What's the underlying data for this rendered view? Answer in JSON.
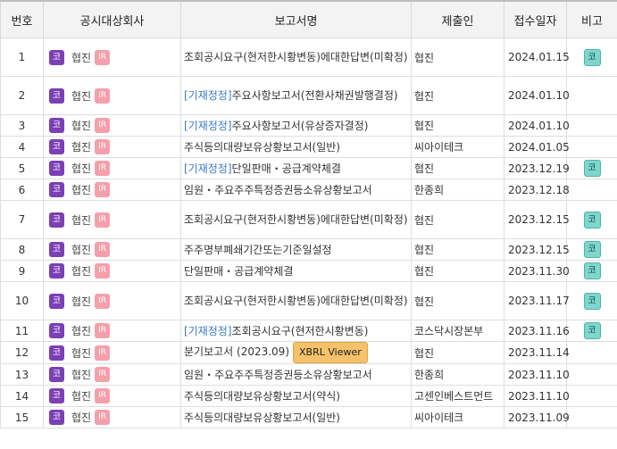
{
  "headers": [
    "번호",
    "공시대상회사",
    "보고서명",
    "제출인",
    "접수일자",
    "비고"
  ],
  "badges": {
    "market": "코",
    "ir": "IR",
    "xbrl": "XBRL Viewer",
    "note": "코"
  },
  "rows": [
    {
      "no": "1",
      "company": "협진",
      "prefix": "",
      "title": "조회공시요구(현저한시황변동)에대한답변(미확정)",
      "submitter": "협진",
      "date": "2024.01.15",
      "note": "코"
    },
    {
      "no": "2",
      "company": "협진",
      "prefix": "[기재정정]",
      "title": "주요사항보고서(전환사채권발행결정)",
      "submitter": "협진",
      "date": "2024.01.10",
      "note": ""
    },
    {
      "no": "3",
      "company": "협진",
      "prefix": "[기재정정]",
      "title": "주요사항보고서(유상증자결정)",
      "submitter": "협진",
      "date": "2024.01.10",
      "note": ""
    },
    {
      "no": "4",
      "company": "협진",
      "prefix": "",
      "title": "주식등의대량보유상황보고서(일반)",
      "submitter": "씨아이테크",
      "date": "2024.01.05",
      "note": ""
    },
    {
      "no": "5",
      "company": "협진",
      "prefix": "[기재정정]",
      "title": "단일판매・공급계약체결",
      "submitter": "협진",
      "date": "2023.12.19",
      "note": "코"
    },
    {
      "no": "6",
      "company": "협진",
      "prefix": "",
      "title": "임원・주요주주특정증권등소유상황보고서",
      "submitter": "한종희",
      "date": "2023.12.18",
      "note": ""
    },
    {
      "no": "7",
      "company": "협진",
      "prefix": "",
      "title": "조회공시요구(현저한시황변동)에대한답변(미확정)",
      "submitter": "협진",
      "date": "2023.12.15",
      "note": "코"
    },
    {
      "no": "8",
      "company": "협진",
      "prefix": "",
      "title": "주주명부폐쇄기간또는기준일설정",
      "submitter": "협진",
      "date": "2023.12.15",
      "note": "코"
    },
    {
      "no": "9",
      "company": "협진",
      "prefix": "",
      "title": "단일판매・공급계약체결",
      "submitter": "협진",
      "date": "2023.11.30",
      "note": "코"
    },
    {
      "no": "10",
      "company": "협진",
      "prefix": "",
      "title": "조회공시요구(현저한시황변동)에대한답변(미확정)",
      "submitter": "협진",
      "date": "2023.11.17",
      "note": "코"
    },
    {
      "no": "11",
      "company": "협진",
      "prefix": "[기재정정]",
      "title": "조회공시요구(현저한시황변동)",
      "submitter": "코스닥시장본부",
      "date": "2023.11.16",
      "note": "코"
    },
    {
      "no": "12",
      "company": "협진",
      "prefix": "",
      "title": "분기보고서 (2023.09)",
      "submitter": "협진",
      "date": "2023.11.14",
      "note": "",
      "xbrl": true
    },
    {
      "no": "13",
      "company": "협진",
      "prefix": "",
      "title": "임원・주요주주특정증권등소유상황보고서",
      "submitter": "한종희",
      "date": "2023.11.10",
      "note": ""
    },
    {
      "no": "14",
      "company": "협진",
      "prefix": "",
      "title": "주식등의대량보유상황보고서(약식)",
      "submitter": "고센인베스트먼트",
      "date": "2023.11.10",
      "note": ""
    },
    {
      "no": "15",
      "company": "협진",
      "prefix": "",
      "title": "주식등의대량보유상황보고서(일반)",
      "submitter": "씨아이테크",
      "date": "2023.11.09",
      "note": ""
    }
  ]
}
